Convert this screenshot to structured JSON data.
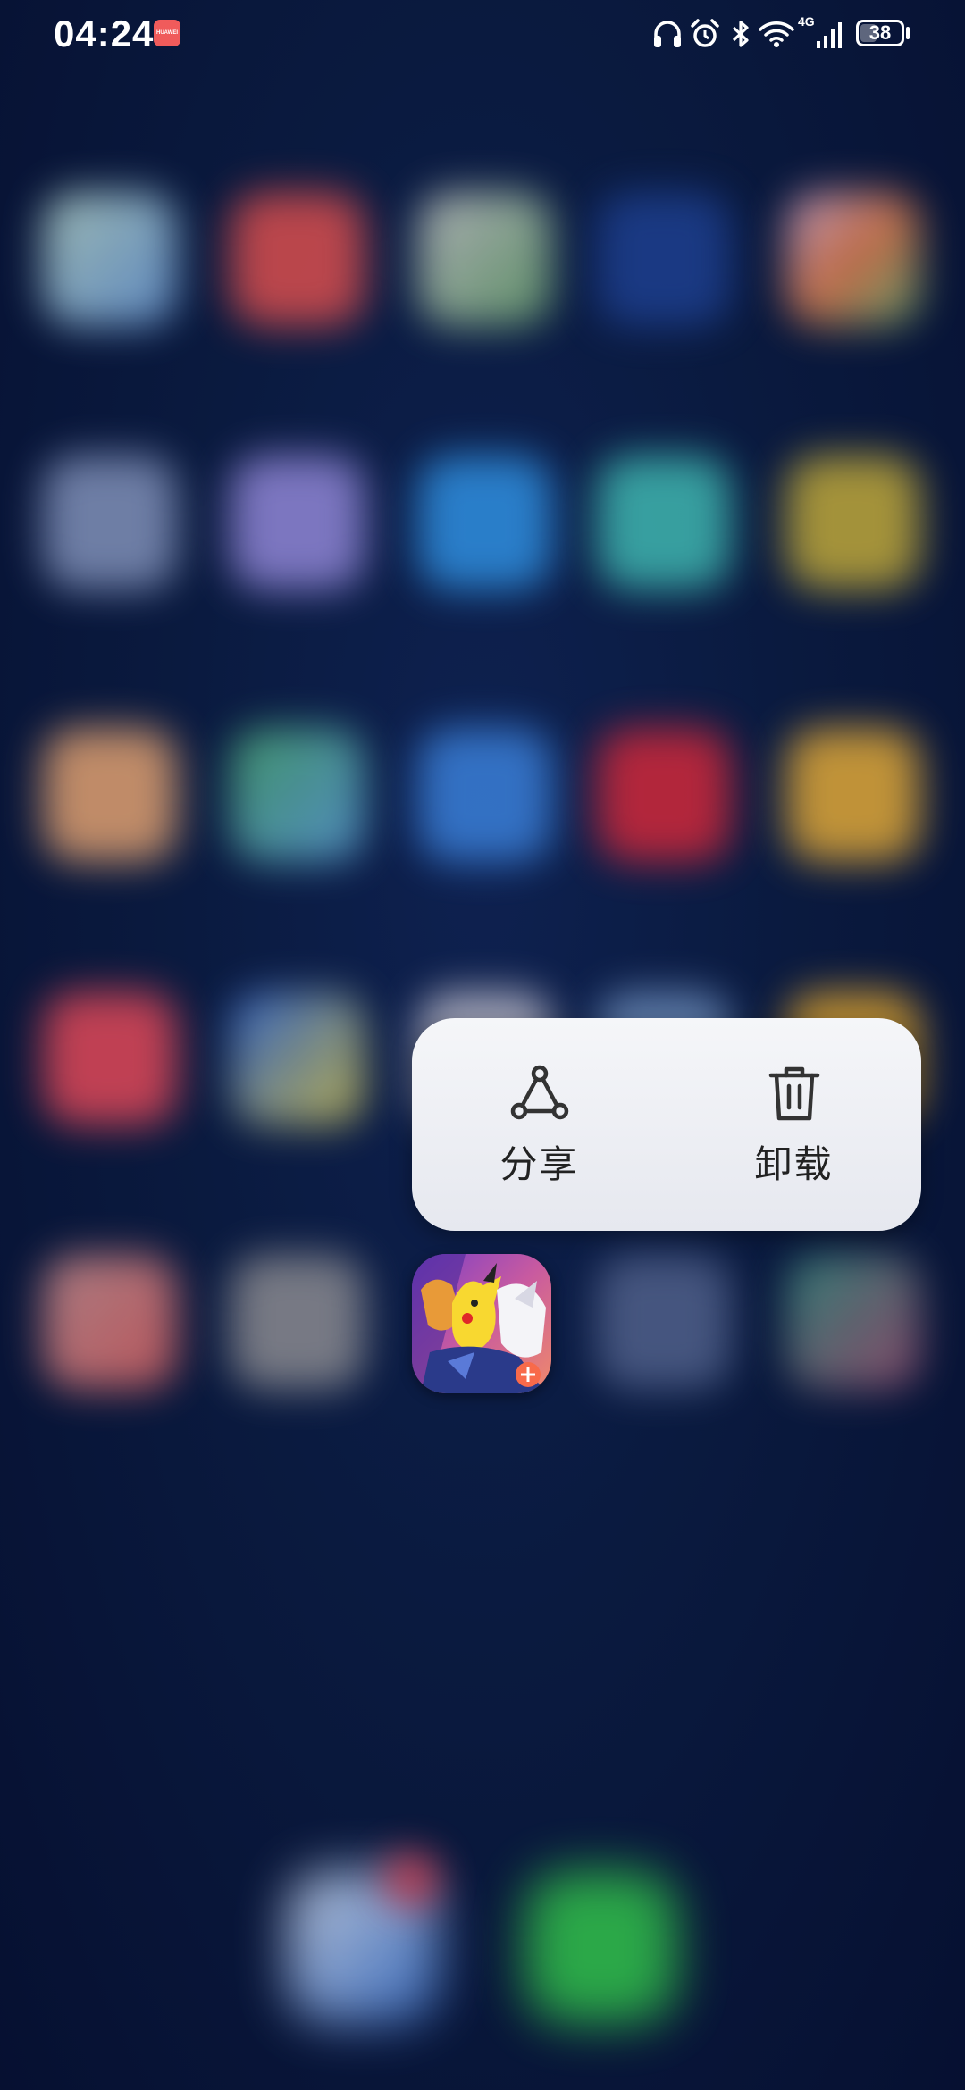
{
  "status_bar": {
    "time": "04:24",
    "notification_badge": "HUAWEI",
    "network_label": "4G",
    "battery_level": "38",
    "battery_fraction": 0.38,
    "icons": [
      "headphones-icon",
      "alarm-icon",
      "bluetooth-icon",
      "wifi-icon",
      "cellular-signal-icon",
      "battery-icon"
    ]
  },
  "popup_menu": {
    "items": [
      {
        "label": "分享",
        "icon": "share-icon"
      },
      {
        "label": "卸载",
        "icon": "trash-icon"
      }
    ]
  },
  "selected_app": {
    "icon": "pokemon-unite-app-icon"
  },
  "colors": {
    "wallpaper": "#0a1a3f",
    "popup_bg": "#eef0f5",
    "popup_text": "#222222",
    "icon_stroke": "#333333",
    "badge": "#f05b5b"
  }
}
